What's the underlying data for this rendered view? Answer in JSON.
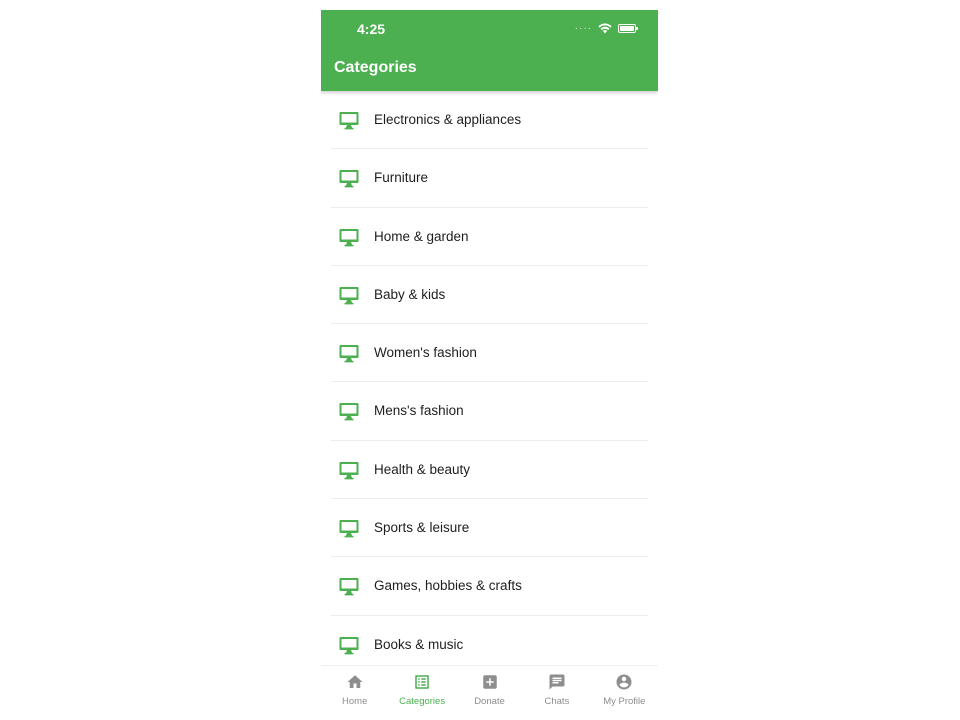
{
  "status_bar": {
    "time": "4:25",
    "signal_icon": "signal-dots-icon",
    "wifi_icon": "wifi-icon",
    "battery_icon": "battery-icon"
  },
  "header": {
    "title": "Categories",
    "background_color": "#4caf50"
  },
  "categories": {
    "icon": "desktop-monitor-icon",
    "icon_color": "#4caf50",
    "items": [
      {
        "label": "Electronics & appliances"
      },
      {
        "label": "Furniture"
      },
      {
        "label": "Home & garden"
      },
      {
        "label": "Baby & kids"
      },
      {
        "label": "Women's fashion"
      },
      {
        "label": "Mens's fashion"
      },
      {
        "label": "Health & beauty"
      },
      {
        "label": "Sports & leisure"
      },
      {
        "label": "Games, hobbies & crafts"
      },
      {
        "label": "Books & music"
      }
    ]
  },
  "tabbar": {
    "active_color": "#4caf50",
    "inactive_color": "#8e8e8e",
    "tabs": [
      {
        "label": "Home",
        "icon": "home-icon",
        "active": false
      },
      {
        "label": "Categories",
        "icon": "list-alt-icon",
        "active": true
      },
      {
        "label": "Donate",
        "icon": "add-box-icon",
        "active": false
      },
      {
        "label": "Chats",
        "icon": "chat-icon",
        "active": false
      },
      {
        "label": "My Profile",
        "icon": "account-circle-icon",
        "active": false
      }
    ]
  }
}
